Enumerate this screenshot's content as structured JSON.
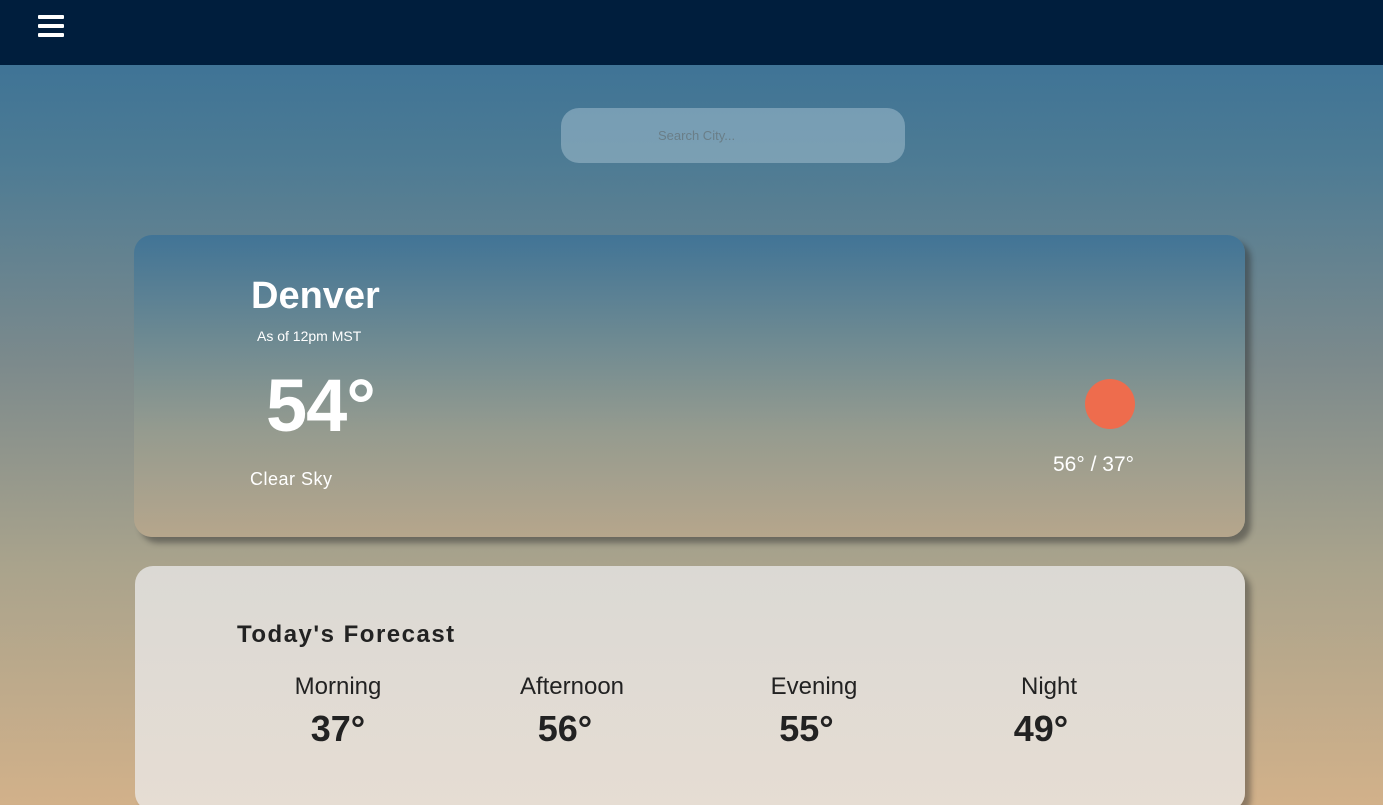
{
  "header": {
    "menu_icon": "hamburger-menu-icon"
  },
  "search": {
    "placeholder": "Search City...",
    "value": ""
  },
  "current": {
    "city": "Denver",
    "as_of": "As of 12pm MST",
    "temperature": "54°",
    "condition": "Clear Sky",
    "condition_icon": "sun-icon",
    "high_low": "56° / 37°"
  },
  "forecast": {
    "title": "Today's Forecast",
    "periods": [
      {
        "label": "Morning",
        "temp": "37°"
      },
      {
        "label": "Afternoon",
        "temp": "56°"
      },
      {
        "label": "Evening",
        "temp": "55°"
      },
      {
        "label": "Night",
        "temp": "49°"
      }
    ]
  },
  "colors": {
    "topbar": "#001e3d",
    "sun": "#ee6c4d",
    "text_light": "#ffffff",
    "text_dark": "#222222"
  }
}
